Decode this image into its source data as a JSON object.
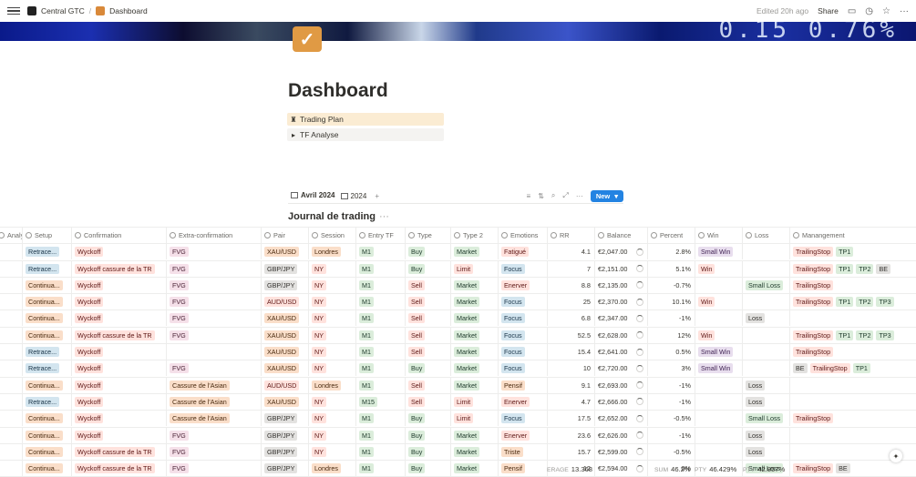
{
  "topbar": {
    "workspace": "Central GTC",
    "separator": "/",
    "page": "Dashboard",
    "edited": "Edited 20h ago",
    "share": "Share"
  },
  "banner_digits": "0.15  0.76%",
  "page_title": "Dashboard",
  "blocks": [
    {
      "icon": "♜",
      "label": "Trading Plan"
    },
    {
      "icon": "▸",
      "label": "TF Analyse"
    }
  ],
  "views": [
    {
      "label": "Avril 2024",
      "active": true
    },
    {
      "label": "2024",
      "active": false
    }
  ],
  "new_label": "New",
  "db_title": "Journal de trading",
  "columns": [
    "Analy...",
    "Setup",
    "Confirmation",
    "Extra-confirmation",
    "Pair",
    "Session",
    "Entry TF",
    "Type",
    "Type 2",
    "Emotions",
    "RR",
    "Balance",
    "Percent",
    "Win",
    "Loss",
    "Manangement"
  ],
  "rows": [
    {
      "setup": "Retrace...",
      "conf": "Wyckoff",
      "extra": "FVG",
      "pair": "XAU/USD",
      "session": "Londres",
      "tf": "M1",
      "type": "Buy",
      "type2": "Market",
      "emo": "Fatigué",
      "rr": "4.1",
      "bal": "€2,047.00",
      "pct": "2.8%",
      "win": "Small Win",
      "loss": "",
      "mgmt": [
        "TrailingStop",
        "TP1"
      ]
    },
    {
      "setup": "Retrace...",
      "conf": "Wyckoff cassure de la TR",
      "extra": "FVG",
      "pair": "GBP/JPY",
      "session": "NY",
      "tf": "M1",
      "type": "Buy",
      "type2": "Limit",
      "emo": "Focus",
      "rr": "7",
      "bal": "€2,151.00",
      "pct": "5.1%",
      "win": "Win",
      "loss": "",
      "mgmt": [
        "TrailingStop",
        "TP1",
        "TP2",
        "BE"
      ]
    },
    {
      "setup": "Continua...",
      "conf": "Wyckoff",
      "extra": "FVG",
      "pair": "GBP/JPY",
      "session": "NY",
      "tf": "M1",
      "type": "Sell",
      "type2": "Market",
      "emo": "Enerver",
      "rr": "8.8",
      "bal": "€2,135.00",
      "pct": "-0.7%",
      "win": "",
      "loss": "Small Loss",
      "mgmt": [
        "TrailingStop"
      ]
    },
    {
      "setup": "Continua...",
      "conf": "Wyckoff",
      "extra": "FVG",
      "pair": "AUD/USD",
      "session": "NY",
      "tf": "M1",
      "type": "Sell",
      "type2": "Market",
      "emo": "Focus",
      "rr": "25",
      "bal": "€2,370.00",
      "pct": "10.1%",
      "win": "Win",
      "loss": "",
      "mgmt": [
        "TrailingStop",
        "TP1",
        "TP2",
        "TP3"
      ]
    },
    {
      "setup": "Continua...",
      "conf": "Wyckoff",
      "extra": "FVG",
      "pair": "XAU/USD",
      "session": "NY",
      "tf": "M1",
      "type": "Sell",
      "type2": "Market",
      "emo": "Focus",
      "rr": "6.8",
      "bal": "€2,347.00",
      "pct": "-1%",
      "win": "",
      "loss": "Loss",
      "mgmt": []
    },
    {
      "setup": "Continua...",
      "conf": "Wyckoff cassure de la TR",
      "extra": "FVG",
      "pair": "XAU/USD",
      "session": "NY",
      "tf": "M1",
      "type": "Sell",
      "type2": "Market",
      "emo": "Focus",
      "rr": "52.5",
      "bal": "€2,628.00",
      "pct": "12%",
      "win": "Win",
      "loss": "",
      "mgmt": [
        "TrailingStop",
        "TP1",
        "TP2",
        "TP3"
      ]
    },
    {
      "setup": "Retrace...",
      "conf": "Wyckoff",
      "extra": "",
      "pair": "XAU/USD",
      "session": "NY",
      "tf": "M1",
      "type": "Sell",
      "type2": "Market",
      "emo": "Focus",
      "rr": "15.4",
      "bal": "€2,641.00",
      "pct": "0.5%",
      "win": "Small Win",
      "loss": "",
      "mgmt": [
        "TrailingStop"
      ]
    },
    {
      "setup": "Retrace...",
      "conf": "Wyckoff",
      "extra": "FVG",
      "pair": "XAU/USD",
      "session": "NY",
      "tf": "M1",
      "type": "Buy",
      "type2": "Market",
      "emo": "Focus",
      "rr": "10",
      "bal": "€2,720.00",
      "pct": "3%",
      "win": "Small Win",
      "loss": "",
      "mgmt": [
        "BE",
        "TrailingStop",
        "TP1"
      ]
    },
    {
      "setup": "Continua...",
      "conf": "Wyckoff",
      "extra": "Cassure de l'Asian",
      "pair": "AUD/USD",
      "session": "Londres",
      "tf": "M1",
      "type": "Sell",
      "type2": "Market",
      "emo": "Pensif",
      "rr": "9.1",
      "bal": "€2,693.00",
      "pct": "-1%",
      "win": "",
      "loss": "Loss",
      "mgmt": []
    },
    {
      "setup": "Retrace...",
      "conf": "Wyckoff",
      "extra": "Cassure de l'Asian",
      "pair": "XAU/USD",
      "session": "NY",
      "tf": "M15",
      "type": "Sell",
      "type2": "Limit",
      "emo": "Enerver",
      "rr": "4.7",
      "bal": "€2,666.00",
      "pct": "-1%",
      "win": "",
      "loss": "Loss",
      "mgmt": []
    },
    {
      "setup": "Continua...",
      "conf": "Wyckoff",
      "extra": "Cassure de l'Asian",
      "pair": "GBP/JPY",
      "session": "NY",
      "tf": "M1",
      "type": "Buy",
      "type2": "Limit",
      "emo": "Focus",
      "rr": "17.5",
      "bal": "€2,652.00",
      "pct": "-0.5%",
      "win": "",
      "loss": "Small Loss",
      "mgmt": [
        "TrailingStop"
      ]
    },
    {
      "setup": "Continua...",
      "conf": "Wyckoff",
      "extra": "FVG",
      "pair": "GBP/JPY",
      "session": "NY",
      "tf": "M1",
      "type": "Buy",
      "type2": "Market",
      "emo": "Enerver",
      "rr": "23.6",
      "bal": "€2,626.00",
      "pct": "-1%",
      "win": "",
      "loss": "Loss",
      "mgmt": []
    },
    {
      "setup": "Continua...",
      "conf": "Wyckoff cassure de la TR",
      "extra": "FVG",
      "pair": "GBP/JPY",
      "session": "NY",
      "tf": "M1",
      "type": "Buy",
      "type2": "Market",
      "emo": "Triste",
      "rr": "15.7",
      "bal": "€2,599.00",
      "pct": "-0.5%",
      "win": "",
      "loss": "Loss",
      "mgmt": []
    },
    {
      "setup": "Continua...",
      "conf": "Wyckoff cassure de la TR",
      "extra": "FVG",
      "pair": "GBP/JPY",
      "session": "Londres",
      "tf": "M1",
      "type": "Buy",
      "type2": "Market",
      "emo": "Pensif",
      "rr": "12",
      "bal": "€2,594.00",
      "pct": "0%",
      "win": "",
      "loss": "Small Loss",
      "mgmt": [
        "TrailingStop",
        "BE"
      ]
    }
  ],
  "footer": {
    "avg_label": "ERAGE",
    "avg_value": "13.368",
    "sum_label": "SUM",
    "sum_value": "46.2%",
    "pct1_label": "PTY",
    "pct1_value": "46.429%",
    "pct2_label": "PTY",
    "pct2_value": "42.857%"
  },
  "colors": {
    "setup": {
      "Retrace...": "blue",
      "Continua...": "orange"
    },
    "conf": "red",
    "extra": {
      "FVG": "pink",
      "Cassure de l'Asian": "orange"
    },
    "pair": {
      "XAU/USD": "orange",
      "GBP/JPY": "gray",
      "AUD/USD": "red"
    },
    "session": {
      "Londres": "orange",
      "NY": "red"
    },
    "tf": "green",
    "type": {
      "Buy": "green",
      "Sell": "red"
    },
    "type2": {
      "Market": "green",
      "Limit": "red"
    },
    "emo": {
      "Fatigué": "red",
      "Focus": "blue",
      "Enerver": "red",
      "Pensif": "orange",
      "Triste": "orange"
    },
    "win": {
      "Small Win": "purple",
      "Win": "red"
    },
    "loss": {
      "Small Loss": "green",
      "Loss": "gray"
    },
    "mgmt": {
      "TrailingStop": "red",
      "TP1": "green",
      "TP2": "green",
      "TP3": "green",
      "BE": "gray"
    },
    "accent": "#2383e2"
  }
}
